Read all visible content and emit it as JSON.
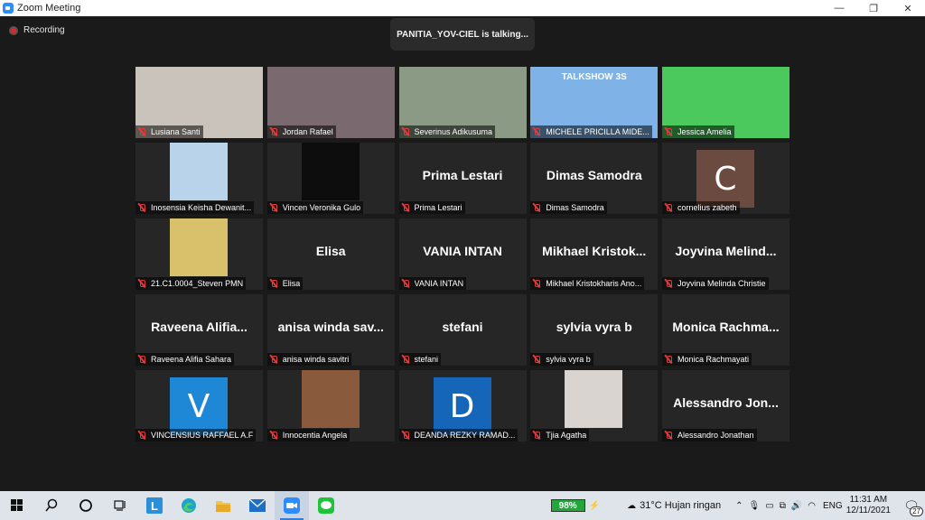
{
  "window": {
    "title": "Zoom Meeting",
    "controls": [
      "—",
      "❐",
      "✕"
    ]
  },
  "meeting": {
    "recording_label": "Recording",
    "talking_banner": "PANITIA_YOV-CIEL is talking..."
  },
  "participants": [
    {
      "name": "Lusiana Santi",
      "kind": "video",
      "bg": "#c9c3bb"
    },
    {
      "name": "Jordan Rafael",
      "kind": "video",
      "bg": "#7a6a6f"
    },
    {
      "name": "Severinus Adikusuma",
      "kind": "video",
      "bg": "#8a9a84"
    },
    {
      "name": "MICHELE PRICILLA MIDE...",
      "kind": "video",
      "bg": "#7fb3e8",
      "overlay": "TALKSHOW 3S"
    },
    {
      "name": "Jessica Amelia",
      "kind": "video",
      "bg": "#4cc95d"
    },
    {
      "name": "Inosensia Keisha Dewanit...",
      "kind": "video",
      "bg": "#b8d3ea"
    },
    {
      "name": "Vincen Veronika Gulo",
      "kind": "video",
      "bg": "#0d0d0d"
    },
    {
      "name": "Prima Lestari",
      "kind": "name",
      "display": "Prima Lestari"
    },
    {
      "name": "Dimas Samodra",
      "kind": "name",
      "display": "Dimas Samodra"
    },
    {
      "name": "cornelius zabeth",
      "kind": "letter",
      "letter": "C",
      "bg": "#6b4a3f"
    },
    {
      "name": "21.C1.0004_Steven PMN",
      "kind": "video",
      "bg": "#d8c16a"
    },
    {
      "name": "Elisa",
      "kind": "name",
      "display": "Elisa"
    },
    {
      "name": "VANIA INTAN",
      "kind": "name",
      "display": "VANIA INTAN"
    },
    {
      "name": "Mikhael Kristokharis Ano...",
      "kind": "name",
      "display": "Mikhael Kristok..."
    },
    {
      "name": "Joyvina Melinda Christie",
      "kind": "name",
      "display": "Joyvina Melind..."
    },
    {
      "name": "Raveena Alifia Sahara",
      "kind": "name",
      "display": "Raveena Alifia..."
    },
    {
      "name": "anisa winda savitri",
      "kind": "name",
      "display": "anisa winda sav..."
    },
    {
      "name": "stefani",
      "kind": "name",
      "display": "stefani"
    },
    {
      "name": "sylvia vyra b",
      "kind": "name",
      "display": "sylvia vyra b"
    },
    {
      "name": "Monica Rachmayati",
      "kind": "name",
      "display": "Monica Rachma..."
    },
    {
      "name": "VINCENSIUS RAFFAEL A.F",
      "kind": "letter",
      "letter": "V",
      "bg": "#1e88d6"
    },
    {
      "name": "Innocentia Angela",
      "kind": "video",
      "bg": "#8a5a3c"
    },
    {
      "name": "DEANDA REZKY RAMAD...",
      "kind": "letter",
      "letter": "D",
      "bg": "#1565b8"
    },
    {
      "name": "Tjia Agatha",
      "kind": "video",
      "bg": "#d9d4cf"
    },
    {
      "name": "Alessandro Jonathan",
      "kind": "name",
      "display": "Alessandro Jon..."
    }
  ],
  "taskbar": {
    "apps": [
      "windows-start",
      "search",
      "cortana",
      "task-view",
      "launcher-L",
      "edge",
      "file-explorer",
      "mail",
      "zoom",
      "line"
    ],
    "battery": "98%",
    "weather": "31°C  Hujan ringan",
    "language": "ENG",
    "time": "11:31 AM",
    "date": "12/11/2021",
    "notifications": "27"
  }
}
